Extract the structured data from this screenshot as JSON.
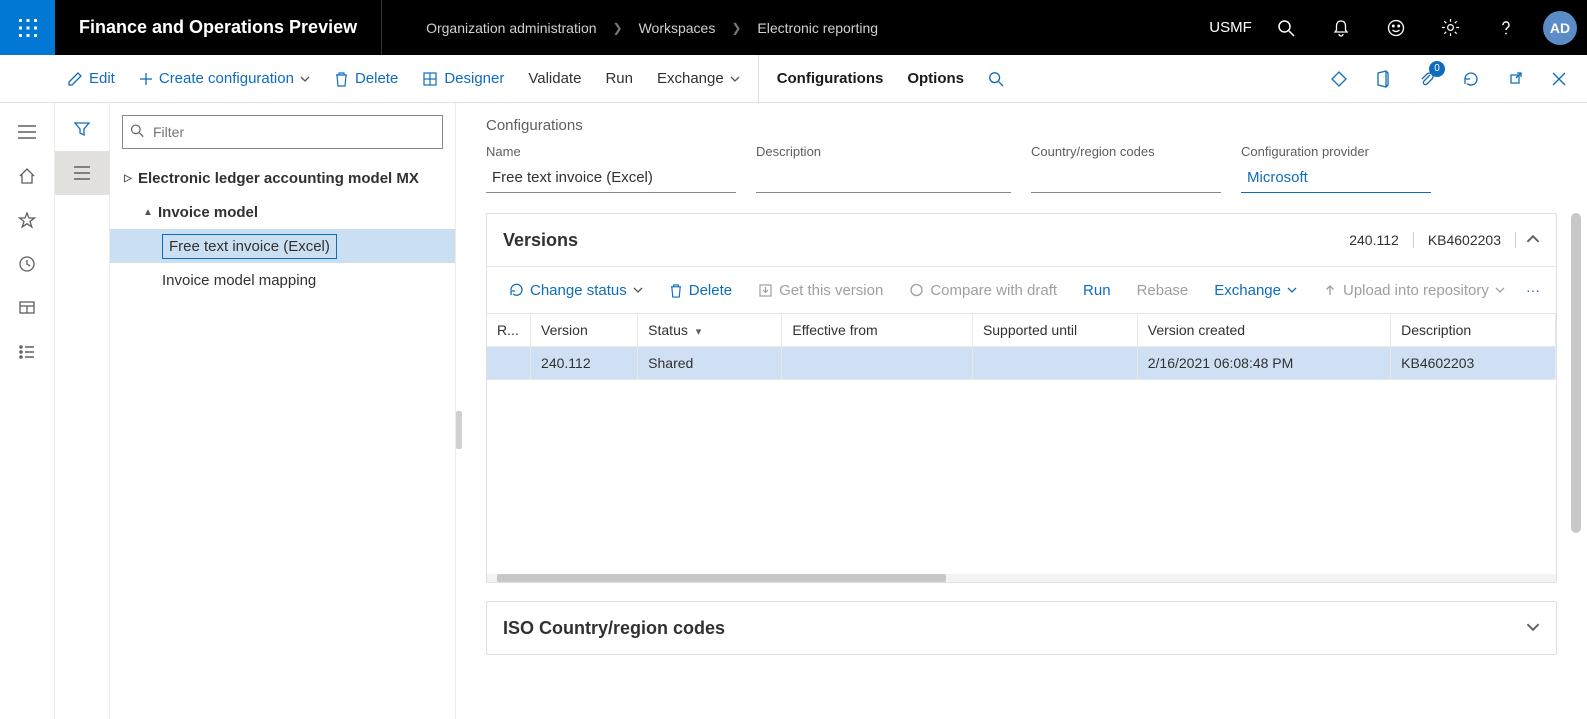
{
  "header": {
    "app_title": "Finance and Operations Preview",
    "company": "USMF",
    "avatar_initials": "AD"
  },
  "breadcrumb": {
    "items": [
      "Organization administration",
      "Workspaces",
      "Electronic reporting"
    ]
  },
  "toolbar": {
    "edit": "Edit",
    "create_config": "Create configuration",
    "delete": "Delete",
    "designer": "Designer",
    "validate": "Validate",
    "run": "Run",
    "exchange": "Exchange",
    "configurations": "Configurations",
    "options": "Options",
    "attachment_badge": "0"
  },
  "tree": {
    "filter_placeholder": "Filter",
    "items": [
      {
        "label": "Electronic ledger accounting model MX",
        "level": 0,
        "expanded": false
      },
      {
        "label": "Invoice model",
        "level": 1,
        "expanded": true
      },
      {
        "label": "Free text invoice (Excel)",
        "level": 2,
        "selected": true
      },
      {
        "label": "Invoice model mapping",
        "level": 2
      }
    ]
  },
  "detail": {
    "breadcrumb_title": "Configurations",
    "fields": {
      "name_label": "Name",
      "name_value": "Free text invoice (Excel)",
      "desc_label": "Description",
      "desc_value": "",
      "codes_label": "Country/region codes",
      "codes_value": "",
      "provider_label": "Configuration provider",
      "provider_value": "Microsoft"
    }
  },
  "versions": {
    "title": "Versions",
    "summary_version": "240.112",
    "summary_desc": "KB4602203",
    "toolbar": {
      "change_status": "Change status",
      "delete": "Delete",
      "get_version": "Get this version",
      "compare_draft": "Compare with draft",
      "run": "Run",
      "rebase": "Rebase",
      "exchange": "Exchange",
      "upload_repo": "Upload into repository"
    },
    "columns": {
      "r": "R...",
      "version": "Version",
      "status": "Status",
      "effective": "Effective from",
      "supported": "Supported until",
      "created": "Version created",
      "description": "Description"
    },
    "rows": [
      {
        "version": "240.112",
        "status": "Shared",
        "effective": "",
        "supported": "",
        "created": "2/16/2021 06:08:48 PM",
        "description": "KB4602203"
      }
    ]
  },
  "iso": {
    "title": "ISO Country/region codes"
  }
}
